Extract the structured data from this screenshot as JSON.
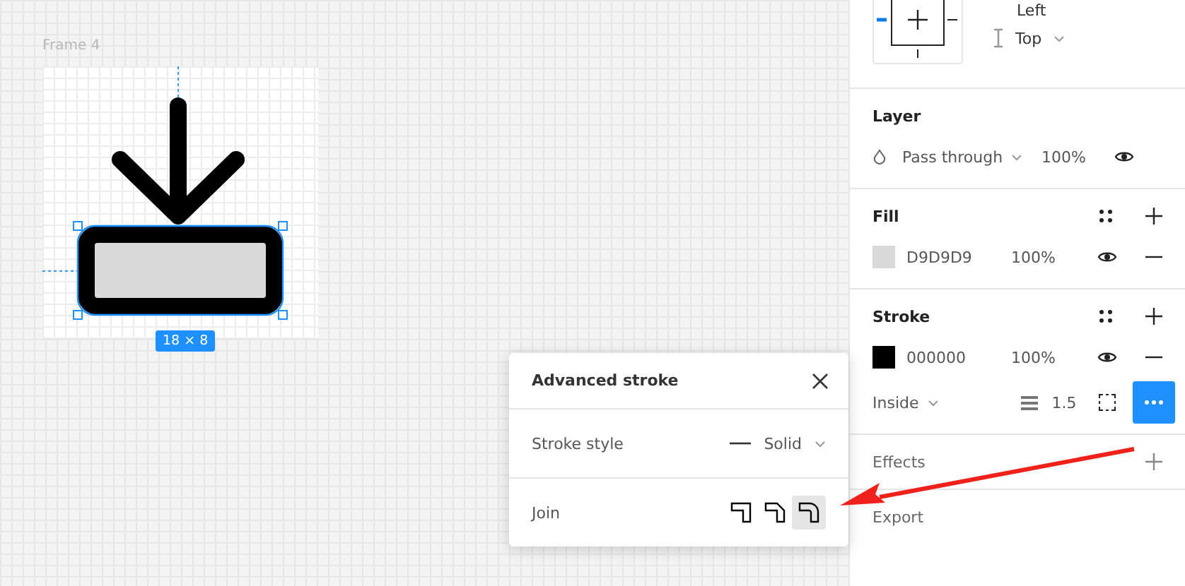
{
  "canvas": {
    "frame_label": "Frame 4",
    "size_badge": "18 × 8"
  },
  "popup": {
    "title": "Advanced stroke",
    "stroke_style": {
      "label": "Stroke style",
      "value": "Solid"
    },
    "join": {
      "label": "Join",
      "options": [
        {
          "kind": "miter",
          "selected": false
        },
        {
          "kind": "bevel",
          "selected": false
        },
        {
          "kind": "round",
          "selected": true
        }
      ]
    }
  },
  "panel": {
    "constraints": {
      "horizontal": "Left",
      "vertical": "Top"
    },
    "layer": {
      "title": "Layer",
      "blend": "Pass through",
      "opacity": "100%"
    },
    "fill": {
      "title": "Fill",
      "items": [
        {
          "hex": "D9D9D9",
          "color": "#d9d9d9",
          "opacity": "100%"
        }
      ]
    },
    "stroke": {
      "title": "Stroke",
      "items": [
        {
          "hex": "000000",
          "color": "#000000",
          "opacity": "100%"
        }
      ],
      "position": "Inside",
      "weight": "1.5"
    },
    "effects": {
      "title": "Effects"
    },
    "export": {
      "title": "Export"
    }
  }
}
